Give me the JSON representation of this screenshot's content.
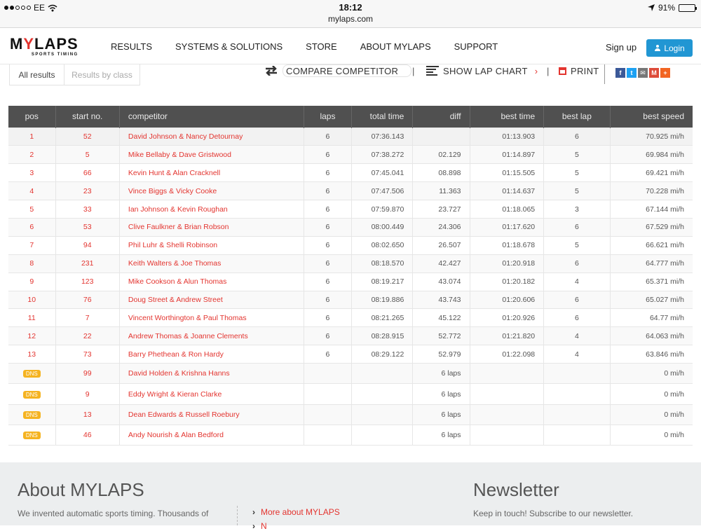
{
  "status_bar": {
    "carrier": "EE",
    "time": "18:12",
    "url": "mylaps.com",
    "battery": "91%",
    "battery_level": 0.91
  },
  "nav": {
    "logo_main": "MYLAPS",
    "logo_sub": "SPORTS TIMING",
    "items": [
      "RESULTS",
      "SYSTEMS & SOLUTIONS",
      "STORE",
      "ABOUT MYLAPS",
      "SUPPORT"
    ],
    "signup": "Sign up",
    "login": "Login"
  },
  "toolbar": {
    "tab_all": "All results",
    "tab_class": "Results by class",
    "compare": "COMPARE COMPETITOR",
    "lap_chart": "SHOW LAP CHART",
    "print": "PRINT",
    "social": [
      {
        "name": "facebook-icon",
        "glyph": "f",
        "color": "#3b5998"
      },
      {
        "name": "twitter-icon",
        "glyph": "t",
        "color": "#1da1f2"
      },
      {
        "name": "email-icon",
        "glyph": "✉",
        "color": "#777777"
      },
      {
        "name": "gmail-icon",
        "glyph": "M",
        "color": "#dd4b39"
      },
      {
        "name": "plus-icon",
        "glyph": "+",
        "color": "#f26522"
      }
    ]
  },
  "table": {
    "headers": [
      "pos",
      "start no.",
      "competitor",
      "laps",
      "total time",
      "diff",
      "best time",
      "best lap",
      "best speed"
    ],
    "rows": [
      {
        "pos": "1",
        "start": "52",
        "name": "David Johnson & Nancy Detournay",
        "laps": "6",
        "total": "07:36.143",
        "diff": "",
        "best_time": "01:13.903",
        "best_lap": "6",
        "speed": "70.925 mi/h"
      },
      {
        "pos": "2",
        "start": "5",
        "name": "Mike Bellaby & Dave Gristwood",
        "laps": "6",
        "total": "07:38.272",
        "diff": "02.129",
        "best_time": "01:14.897",
        "best_lap": "5",
        "speed": "69.984 mi/h"
      },
      {
        "pos": "3",
        "start": "66",
        "name": "Kevin Hunt & Alan Cracknell",
        "laps": "6",
        "total": "07:45.041",
        "diff": "08.898",
        "best_time": "01:15.505",
        "best_lap": "5",
        "speed": "69.421 mi/h"
      },
      {
        "pos": "4",
        "start": "23",
        "name": "Vince Biggs & Vicky Cooke",
        "laps": "6",
        "total": "07:47.506",
        "diff": "11.363",
        "best_time": "01:14.637",
        "best_lap": "5",
        "speed": "70.228 mi/h"
      },
      {
        "pos": "5",
        "start": "33",
        "name": "Ian Johnson & Kevin Roughan",
        "laps": "6",
        "total": "07:59.870",
        "diff": "23.727",
        "best_time": "01:18.065",
        "best_lap": "3",
        "speed": "67.144 mi/h"
      },
      {
        "pos": "6",
        "start": "53",
        "name": "Clive Faulkner & Brian Robson",
        "laps": "6",
        "total": "08:00.449",
        "diff": "24.306",
        "best_time": "01:17.620",
        "best_lap": "6",
        "speed": "67.529 mi/h"
      },
      {
        "pos": "7",
        "start": "94",
        "name": "Phil Luhr & Shelli Robinson",
        "laps": "6",
        "total": "08:02.650",
        "diff": "26.507",
        "best_time": "01:18.678",
        "best_lap": "5",
        "speed": "66.621 mi/h"
      },
      {
        "pos": "8",
        "start": "231",
        "name": "Keith Walters & Joe Thomas",
        "laps": "6",
        "total": "08:18.570",
        "diff": "42.427",
        "best_time": "01:20.918",
        "best_lap": "6",
        "speed": "64.777 mi/h"
      },
      {
        "pos": "9",
        "start": "123",
        "name": "Mike Cookson & Alun Thomas",
        "laps": "6",
        "total": "08:19.217",
        "diff": "43.074",
        "best_time": "01:20.182",
        "best_lap": "4",
        "speed": "65.371 mi/h"
      },
      {
        "pos": "10",
        "start": "76",
        "name": "Doug Street & Andrew Street",
        "laps": "6",
        "total": "08:19.886",
        "diff": "43.743",
        "best_time": "01:20.606",
        "best_lap": "6",
        "speed": "65.027 mi/h"
      },
      {
        "pos": "11",
        "start": "7",
        "name": "Vincent Worthington & Paul Thomas",
        "laps": "6",
        "total": "08:21.265",
        "diff": "45.122",
        "best_time": "01:20.926",
        "best_lap": "6",
        "speed": "64.77 mi/h"
      },
      {
        "pos": "12",
        "start": "22",
        "name": "Andrew Thomas & Joanne Clements",
        "laps": "6",
        "total": "08:28.915",
        "diff": "52.772",
        "best_time": "01:21.820",
        "best_lap": "4",
        "speed": "64.063 mi/h"
      },
      {
        "pos": "13",
        "start": "73",
        "name": "Barry Phethean & Ron Hardy",
        "laps": "6",
        "total": "08:29.122",
        "diff": "52.979",
        "best_time": "01:22.098",
        "best_lap": "4",
        "speed": "63.846 mi/h"
      },
      {
        "pos": "DNS",
        "start": "99",
        "name": "David Holden & Krishna Hanns",
        "laps": "",
        "total": "",
        "diff": "6 laps",
        "best_time": "",
        "best_lap": "",
        "speed": "0 mi/h"
      },
      {
        "pos": "DNS",
        "start": "9",
        "name": "Eddy Wright & Kieran Clarke",
        "laps": "",
        "total": "",
        "diff": "6 laps",
        "best_time": "",
        "best_lap": "",
        "speed": "0 mi/h"
      },
      {
        "pos": "DNS",
        "start": "13",
        "name": "Dean Edwards & Russell Roebury",
        "laps": "",
        "total": "",
        "diff": "6 laps",
        "best_time": "",
        "best_lap": "",
        "speed": "0 mi/h"
      },
      {
        "pos": "DNS",
        "start": "46",
        "name": "Andy Nourish & Alan Bedford",
        "laps": "",
        "total": "",
        "diff": "6 laps",
        "best_time": "",
        "best_lap": "",
        "speed": "0 mi/h"
      }
    ]
  },
  "footer": {
    "about_title": "About MYLAPS",
    "about_text": "We invented automatic sports timing. Thousands of",
    "links": [
      "More about MYLAPS",
      "N"
    ],
    "newsletter_title": "Newsletter",
    "newsletter_text": "Keep in touch! Subscribe to our newsletter."
  }
}
